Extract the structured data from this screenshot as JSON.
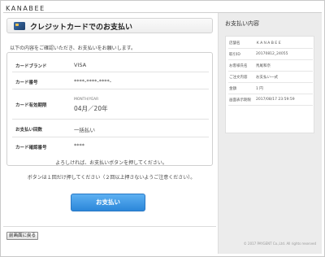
{
  "brand": "KANABEE",
  "header": {
    "title": "クレジットカードでのお支払い"
  },
  "intro": "以下の内容をご確認いただき、お支払いをお願いします。",
  "fields": {
    "card_brand_label": "カードブランド",
    "card_brand_value": "VISA",
    "card_number_label": "カード番号",
    "card_number_value": "****-****-****-",
    "expiry_label": "カード有効期限",
    "expiry_sub": "MONTH/YEAR",
    "expiry_value": "04月／20年",
    "count_label": "お支払い回数",
    "count_value": "一括払い",
    "cvc_label": "カード確認番号",
    "cvc_value": "****"
  },
  "note1": "よろしければ、お支払いボタンを押してください。",
  "note2": "ボタンは１回だけ押してください（２回以上押さないようご注意ください）。",
  "pay_button": "お支払い",
  "back_button": "前画面に戻る",
  "summary": {
    "title": "お支払い内容",
    "rows": [
      {
        "k": "店舗名",
        "v": "ＫＡＮＡＢＥＥ"
      },
      {
        "k": "取引ID",
        "v": "20170812_24055"
      },
      {
        "k": "お客様氏名",
        "v": "馬尾和奈"
      },
      {
        "k": "ご注文内容",
        "v": "お支払い一式"
      },
      {
        "k": "金額",
        "v": "1 円"
      },
      {
        "k": "画面表示期限",
        "v": "2017/08/17 23:59:59"
      }
    ]
  },
  "copyright": "© 2017 PAYGENT Co.,Ltd. All rights reserved"
}
